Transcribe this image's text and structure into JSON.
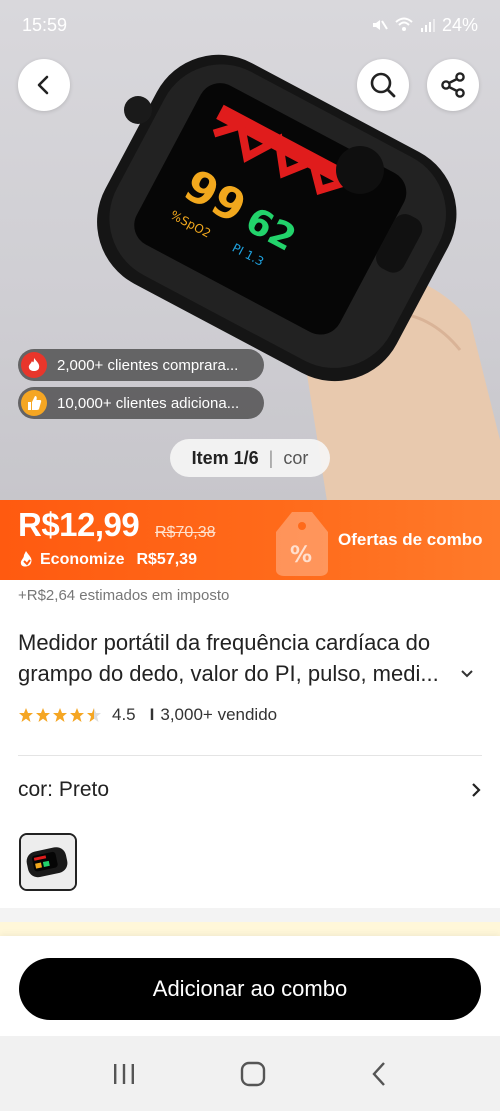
{
  "status_bar": {
    "time": "15:59",
    "battery": "24%"
  },
  "icons": {
    "back": "chevron-left-icon",
    "search": "search-icon",
    "share": "share-icon",
    "fire": "fire-icon",
    "thumbs": "thumbs-up-icon",
    "savings": "flame-arrow-icon"
  },
  "hero": {
    "social_proof": [
      {
        "text": "2,000+ clientes comprara..."
      },
      {
        "text": "10,000+ clientes adiciona..."
      }
    ],
    "item_counter": {
      "current": "Item 1/6",
      "option": "cor"
    }
  },
  "price": {
    "current": "R$12,99",
    "original": "R$70,38",
    "save_label": "Economize",
    "save_amount": "R$57,39",
    "combo_label": "Ofertas de combo"
  },
  "tax_note": "+R$2,64 estimados em imposto",
  "product": {
    "title": "Medidor portátil da frequência cardíaca do grampo do dedo, valor do PI, pulso, medi...",
    "rating": "4.5",
    "rating_stars": 4.5,
    "sold": "3,000+ vendido"
  },
  "variant": {
    "label": "cor: Preto"
  },
  "actions": {
    "add_combo": "Adicionar ao combo"
  },
  "colors": {
    "accent": "#ff5a10",
    "star": "#f5a623",
    "primary_button": "#000000"
  }
}
